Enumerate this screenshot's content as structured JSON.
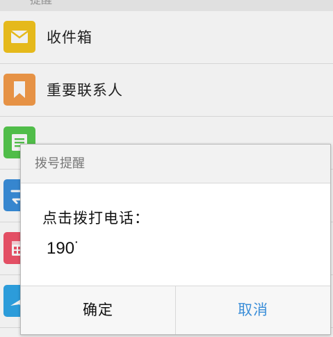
{
  "header": {
    "partial_title": "一提醒"
  },
  "list": {
    "items": [
      {
        "label": "收件箱",
        "icon": "envelope-icon",
        "color": "#f4c51d"
      },
      {
        "label": "重要联系人",
        "icon": "bookmark-icon",
        "color": "#f59c4a"
      },
      {
        "label": "",
        "icon": "note-icon",
        "color": "#55c94e"
      },
      {
        "label": "",
        "icon": "transfer-icon",
        "color": "#3a8fdc"
      },
      {
        "label": "",
        "icon": "calendar-icon",
        "color": "#f2546b"
      },
      {
        "label": "",
        "icon": "paper-plane-icon",
        "color": "#2fa6e8"
      }
    ]
  },
  "dialog": {
    "title": "拨号提醒",
    "message": "点击拨打电话：",
    "number": "190˙",
    "confirm_label": "确定",
    "cancel_label": "取消",
    "accent_color": "#3b8ed8"
  }
}
